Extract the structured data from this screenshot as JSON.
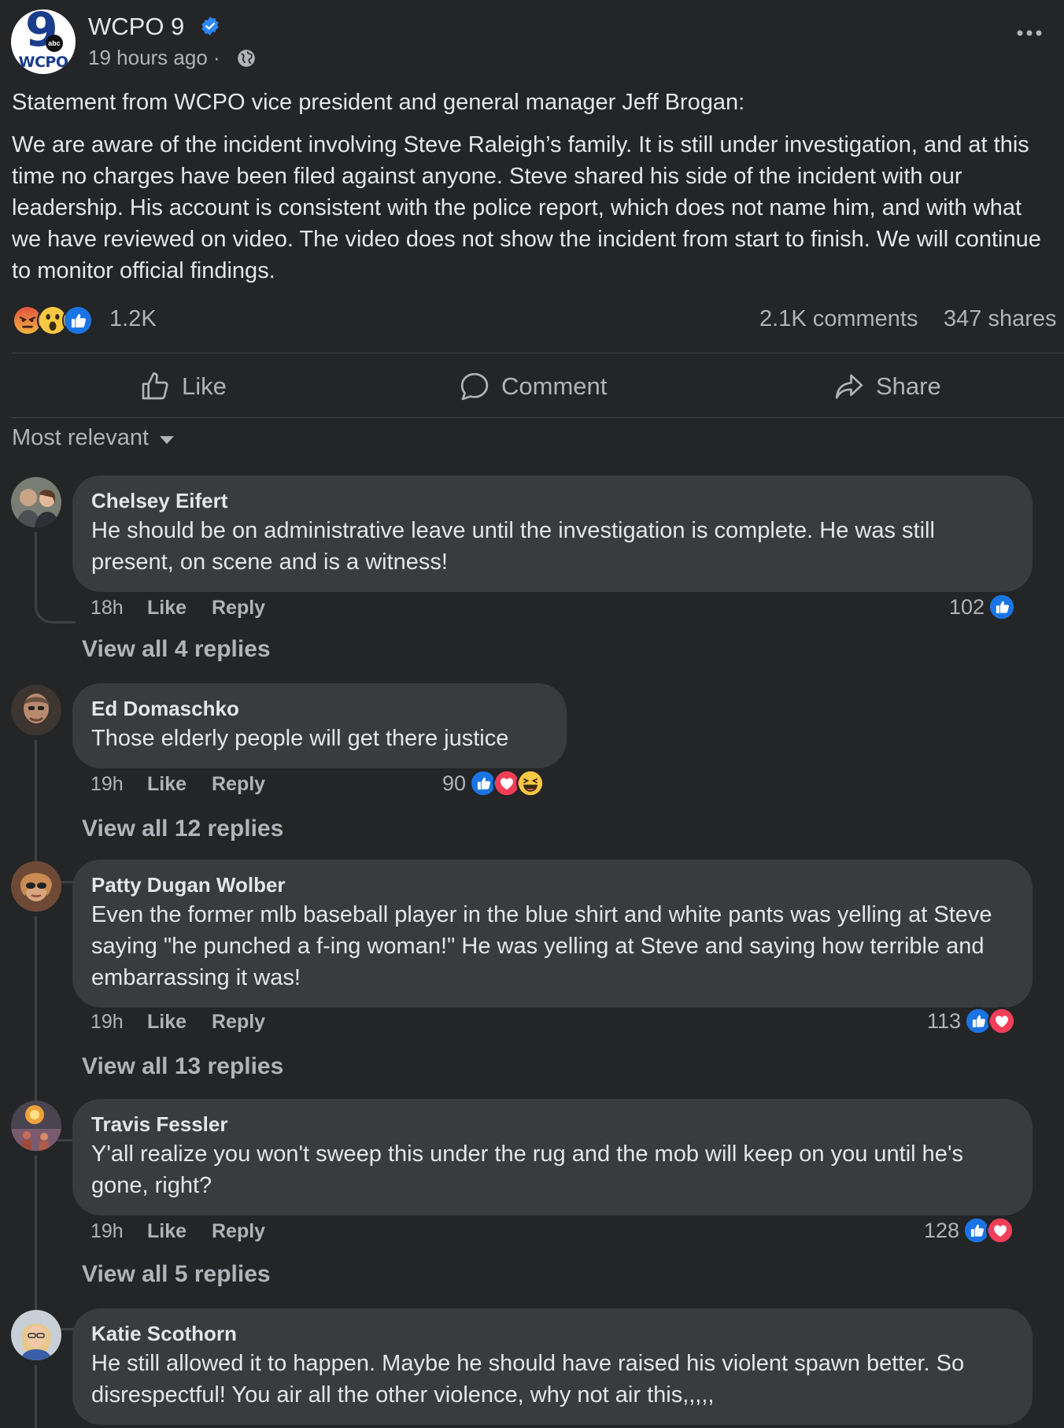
{
  "post": {
    "page_name": "WCPO 9",
    "avatar_text": {
      "number": "9",
      "network": "abc",
      "callsign": "WCPO"
    },
    "time": "19 hours ago ·",
    "paragraphs": [
      "Statement from WCPO vice president and general manager Jeff Brogan:",
      "We are aware of the incident involving Steve Raleigh’s family. It is still under investigation, and at this time no charges have been filed against anyone. Steve shared his side of the incident with our leadership. His account is consistent with the police report, which does not name him, and with what we have reviewed on video. The video does not show the incident from start to finish. We will continue to monitor official findings."
    ],
    "reaction_count": "1.2K",
    "reactions": [
      "angry",
      "wow",
      "like"
    ],
    "comments_count": "2.1K comments",
    "shares_count": "347 shares"
  },
  "actions": {
    "like": "Like",
    "comment": "Comment",
    "share": "Share"
  },
  "sort_label": "Most relevant",
  "comment_actions": {
    "like": "Like",
    "reply": "Reply"
  },
  "comments": [
    {
      "name": "Chelsey Eifert",
      "text": "He should be on administrative leave until the investigation is complete. He was still present, on scene and is a witness!",
      "time": "18h",
      "reaction_count": "102",
      "reactions": [
        "like"
      ],
      "replies": "View all 4 replies"
    },
    {
      "name": "Ed Domaschko",
      "text": "Those elderly people will get there justice",
      "time": "19h",
      "reaction_count": "90",
      "reactions": [
        "like",
        "love",
        "haha"
      ],
      "replies": "View all 12 replies"
    },
    {
      "name": "Patty Dugan Wolber",
      "text": "Even the former mlb baseball player in the blue shirt and white pants was yelling at Steve saying \"he punched a f-ing woman!\" He was yelling at Steve and saying how terrible and embarrassing it was!",
      "time": "19h",
      "reaction_count": "113",
      "reactions": [
        "like",
        "love"
      ],
      "replies": "View all 13 replies"
    },
    {
      "name": "Travis Fessler",
      "text": "Y'all realize you won't sweep this under the rug and the mob will keep on you until he's gone, right?",
      "time": "19h",
      "reaction_count": "128",
      "reactions": [
        "like",
        "love"
      ],
      "replies": "View all 5 replies"
    },
    {
      "name": "Katie Scothorn",
      "text": "He still allowed it to happen. Maybe he should have raised his violent spawn better. So disrespectful! You air all the other violence, why not air this,,,,,",
      "time": "",
      "reaction_count": "",
      "reactions": [],
      "replies": ""
    }
  ],
  "colors": {
    "background": "#242526",
    "bubble": "#3a3b3c",
    "text_primary": "#e4e6eb",
    "text_secondary": "#b0b3b8",
    "like_blue": "#1b74e4",
    "love_red": "#f33e58",
    "verified_blue": "#2d88ff"
  }
}
